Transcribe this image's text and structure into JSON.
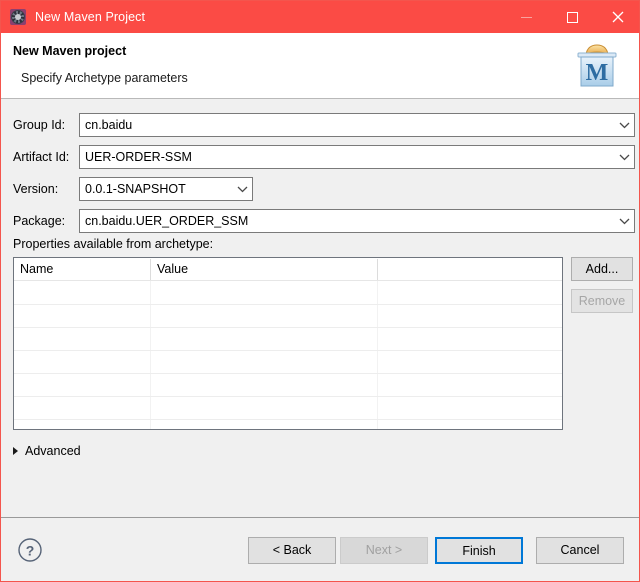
{
  "window": {
    "title": "New Maven Project",
    "icon": "maven-gear-icon",
    "titlebar_color": "#fb4b45",
    "controls": {
      "minimize": "minimize-icon",
      "maximize": "maximize-icon",
      "close": "close-icon"
    }
  },
  "header": {
    "title": "New Maven project",
    "subtitle": "Specify Archetype parameters",
    "logo": "maven-logo-icon",
    "logo_letter": "M"
  },
  "form": {
    "fields": [
      {
        "label": "Group Id:",
        "value": "cn.baidu",
        "type": "combo",
        "width": "full"
      },
      {
        "label": "Artifact Id:",
        "value": "UER-ORDER-SSM",
        "type": "combo",
        "width": "full"
      },
      {
        "label": "Version:",
        "value": "0.0.1-SNAPSHOT",
        "type": "combo",
        "width": "short"
      },
      {
        "label": "Package:",
        "value": "cn.baidu.UER_ORDER_SSM",
        "type": "combo",
        "width": "full"
      }
    ]
  },
  "properties": {
    "section_label": "Properties available from archetype:",
    "columns": [
      "Name",
      "Value"
    ],
    "rows": [],
    "row_count": 7,
    "buttons": {
      "add": {
        "label": "Add...",
        "enabled": true
      },
      "remove": {
        "label": "Remove",
        "enabled": false
      }
    }
  },
  "advanced": {
    "label": "Advanced",
    "expanded": false,
    "toggle_icon": "triangle-right-icon"
  },
  "footer": {
    "help": "help-icon",
    "buttons": {
      "back": {
        "label": "< Back",
        "enabled": true,
        "default": false
      },
      "next": {
        "label": "Next >",
        "enabled": false,
        "default": false
      },
      "finish": {
        "label": "Finish",
        "enabled": true,
        "default": true
      },
      "cancel": {
        "label": "Cancel",
        "enabled": true,
        "default": false
      }
    }
  },
  "colors": {
    "titlebar": "#fb4b45",
    "accent": "#0078d7",
    "body": "#f0f0f0",
    "maven_blue": "#2d6ca2",
    "maven_orange": "#f0ba5a"
  }
}
